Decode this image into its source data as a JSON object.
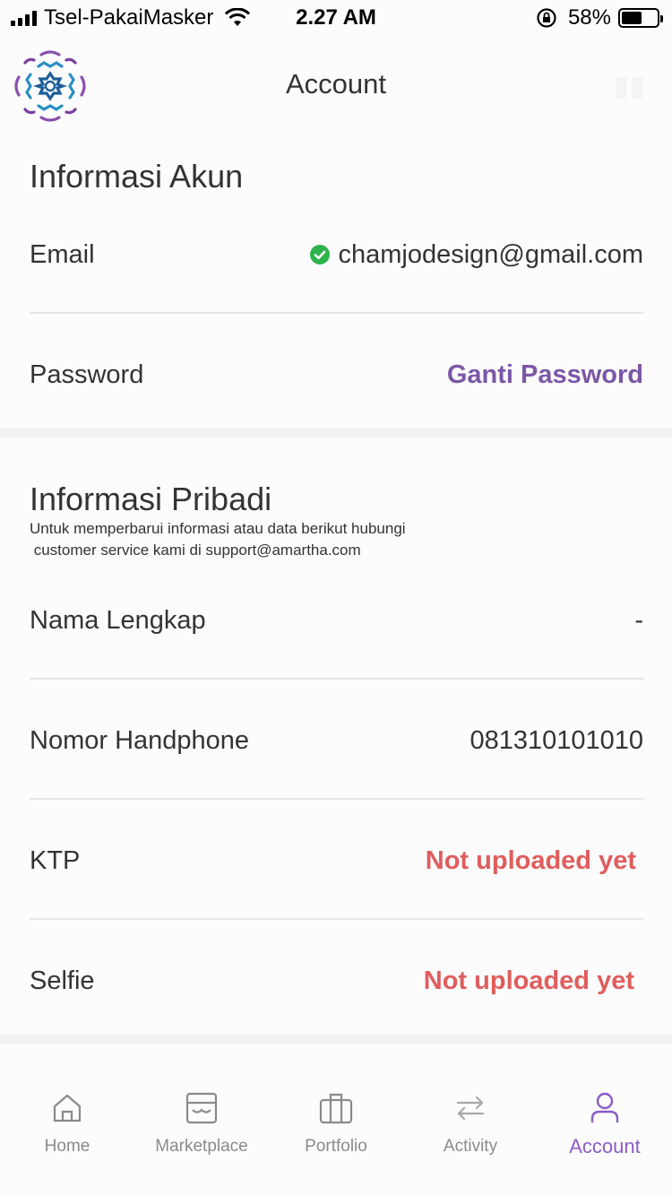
{
  "status_bar": {
    "carrier": "Tsel-PakaiMasker",
    "time": "2.27 AM",
    "battery_pct": "58%",
    "battery_level": 0.58,
    "icons": [
      "signal-icon",
      "wifi-icon",
      "rotation-lock-icon",
      "battery-icon"
    ]
  },
  "header": {
    "title": "Account",
    "logo_icon": "brand-logo-icon"
  },
  "account_info": {
    "title": "Informasi Akun",
    "email_label": "Email",
    "email_value": "chamjodesign@gmail.com",
    "email_verified_icon": "check-circle-icon",
    "password_label": "Password",
    "password_action": "Ganti Password"
  },
  "personal_info": {
    "title": "Informasi Pribadi",
    "note": "Untuk memperbarui informasi atau data berikut hubungi\n customer service kami di support@amartha.com",
    "rows": [
      {
        "label": "Nama Lengkap",
        "value": "-"
      },
      {
        "label": "Nomor Handphone",
        "value": "081310101010"
      },
      {
        "label": "KTP",
        "value": "Not uploaded yet"
      },
      {
        "label": "Selfie",
        "value": "Not uploaded yet"
      }
    ]
  },
  "tabs": [
    {
      "label": "Home",
      "icon": "home-icon"
    },
    {
      "label": "Marketplace",
      "icon": "marketplace-icon"
    },
    {
      "label": "Portfolio",
      "icon": "portfolio-icon"
    },
    {
      "label": "Activity",
      "icon": "activity-icon"
    },
    {
      "label": "Account",
      "icon": "account-icon",
      "active": true
    }
  ],
  "colors": {
    "accent": "#8a5cc6",
    "link": "#7b57a6",
    "warning": "#e05d5d",
    "verified": "#2eb24c",
    "inactive": "#8a8a8a"
  }
}
